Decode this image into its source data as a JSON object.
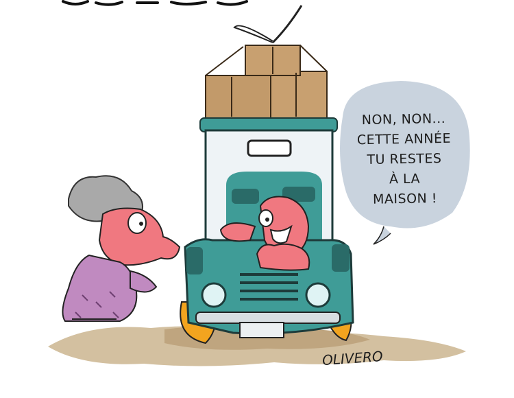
{
  "bubble": {
    "lines": [
      "NON, NON...",
      "CETTE ANNÉE",
      "TU RESTES",
      "À LA",
      "MAISON !"
    ]
  },
  "signature": "OLIVERO",
  "colors": {
    "car_body": "#3f9c97",
    "car_dark": "#2a6b68",
    "bubble": "#c9d3de",
    "box": "#c29a6a",
    "dress": "#c08ac0",
    "skin": "#f07880",
    "hair": "#a9a9a9",
    "ground": "#cbb696"
  }
}
